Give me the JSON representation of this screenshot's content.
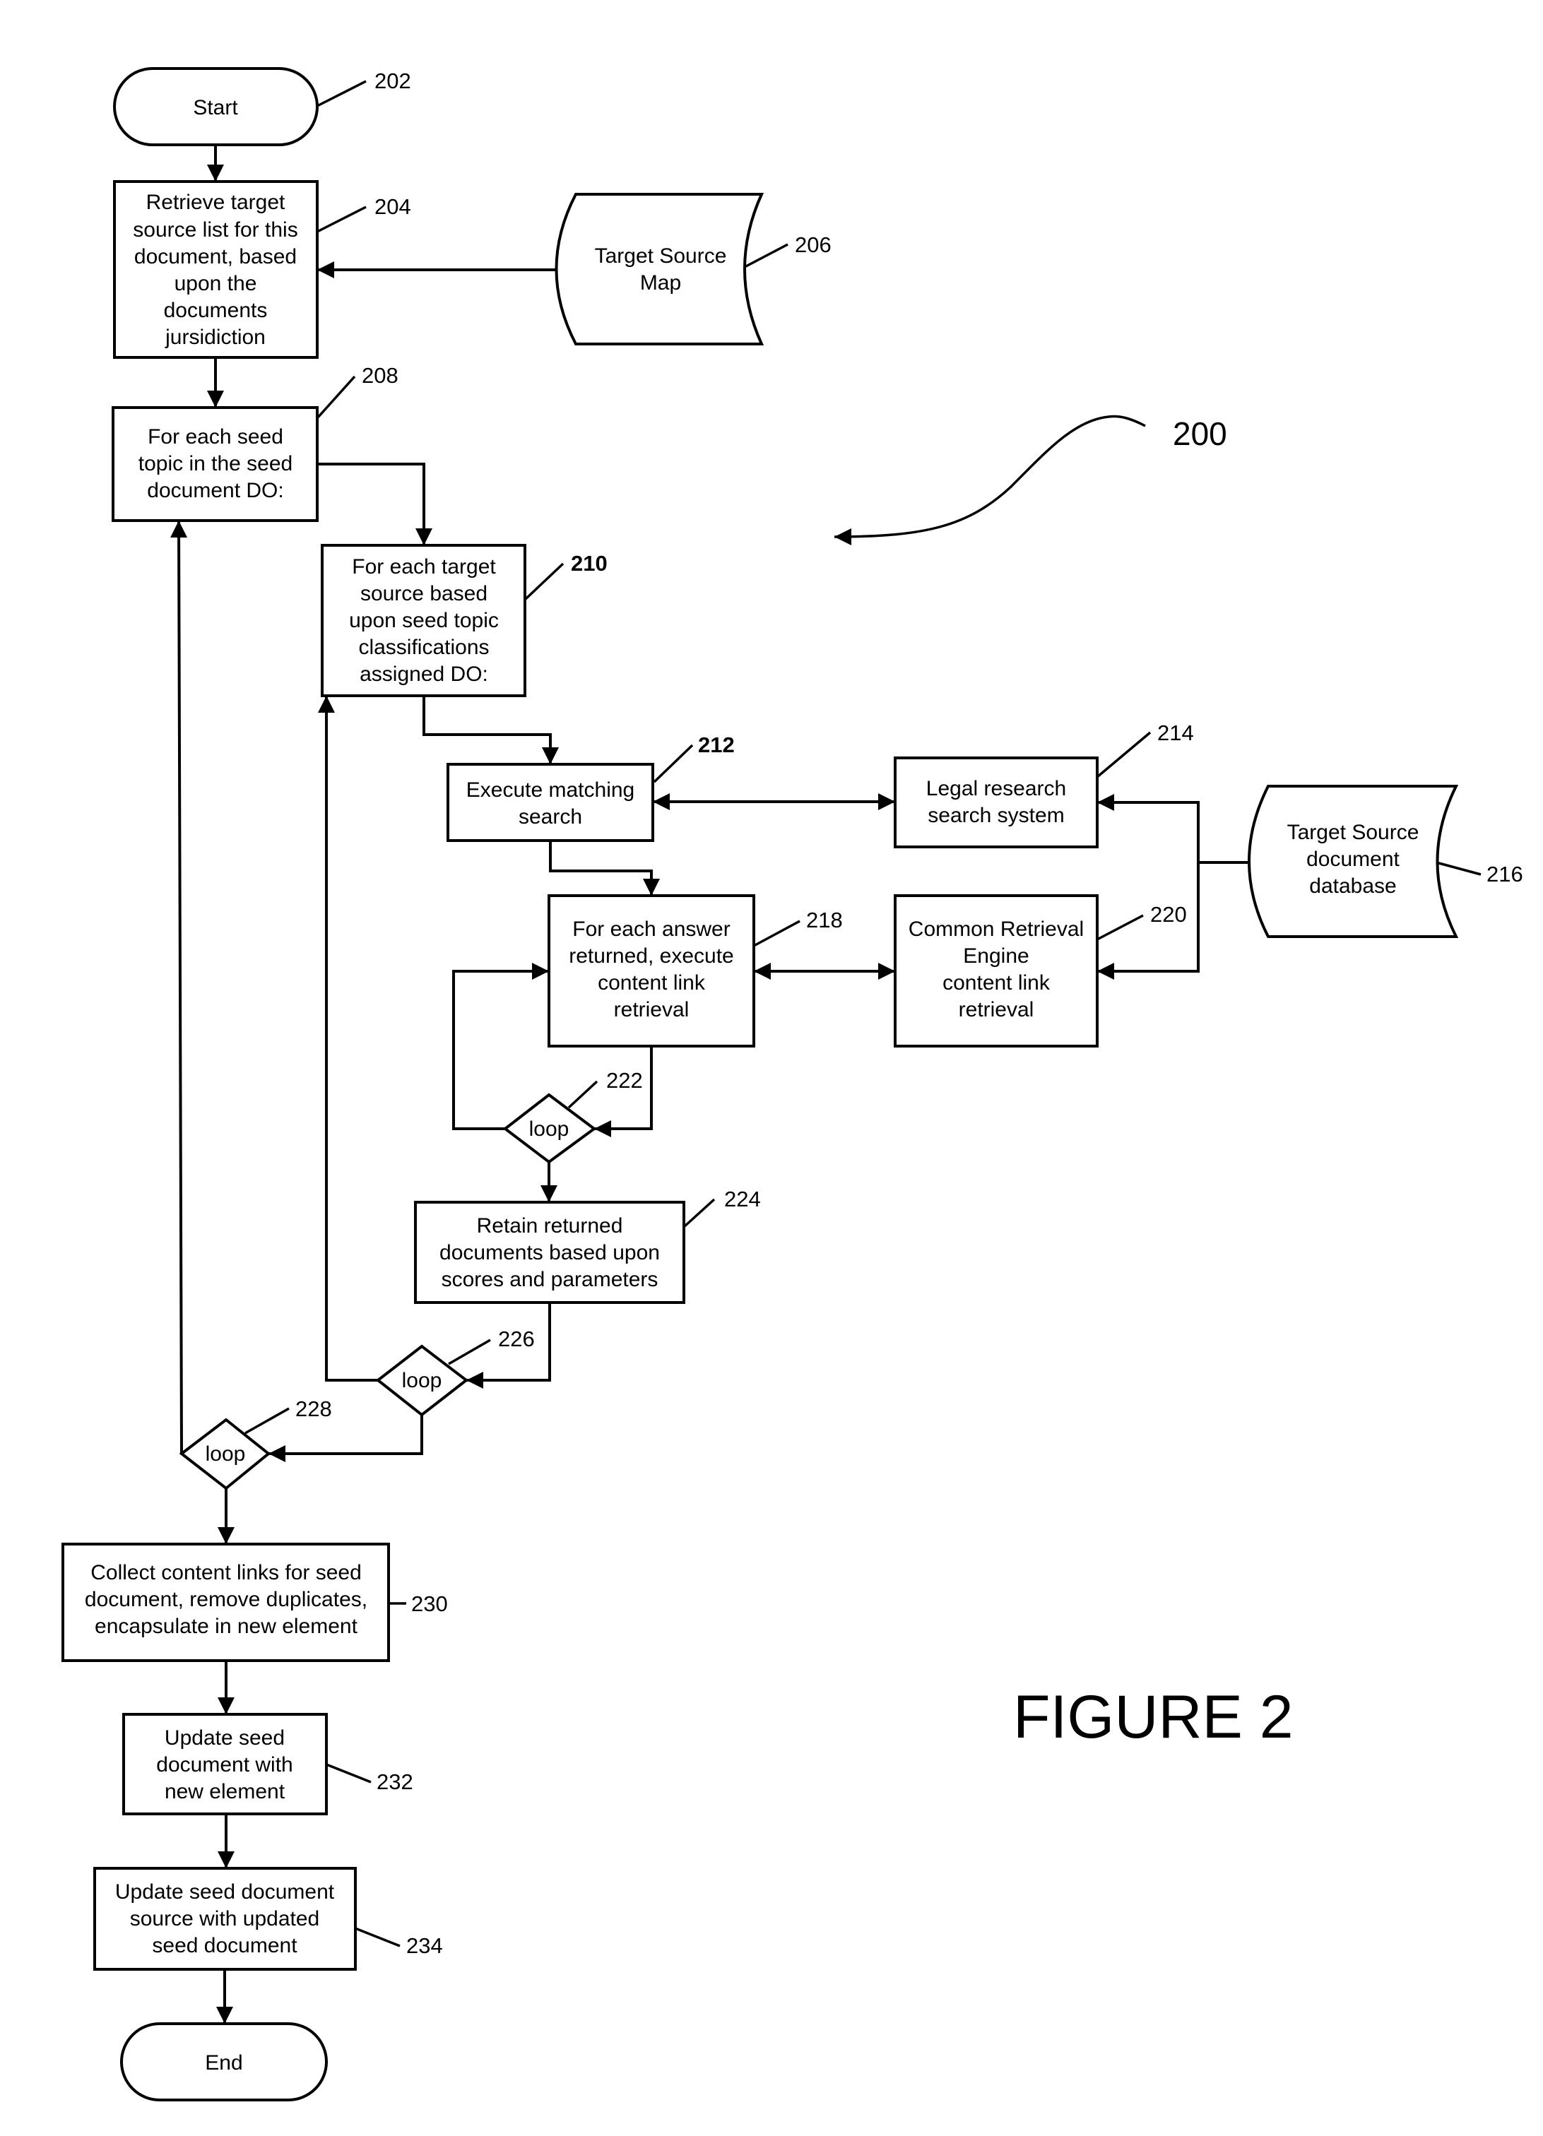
{
  "figure": {
    "caption": "FIGURE 2",
    "reference_number": "200"
  },
  "nodes": {
    "start": {
      "ref": "202",
      "shape": "terminator",
      "lines": [
        "Start"
      ]
    },
    "retrieve_target_list": {
      "ref": "204",
      "shape": "process",
      "lines": [
        "Retrieve target",
        "source list for this",
        "document, based",
        "upon the",
        "documents",
        "jursidiction"
      ]
    },
    "target_source_map": {
      "ref": "206",
      "shape": "stored-data",
      "lines": [
        "Target Source",
        "Map"
      ]
    },
    "for_each_seed_topic": {
      "ref": "208",
      "shape": "process",
      "lines": [
        "For each seed",
        "topic in the seed",
        "document DO:"
      ]
    },
    "for_each_target_source": {
      "ref": "210",
      "shape": "process",
      "lines": [
        "For each target",
        "source based",
        "upon seed topic",
        "classifications",
        "assigned DO:"
      ]
    },
    "execute_matching_search": {
      "ref": "212",
      "shape": "process",
      "lines": [
        "Execute matching",
        "search"
      ]
    },
    "legal_research_system": {
      "ref": "214",
      "shape": "process",
      "lines": [
        "Legal research",
        "search system"
      ]
    },
    "target_source_db": {
      "ref": "216",
      "shape": "stored-data",
      "lines": [
        "Target Source",
        "document",
        "database"
      ]
    },
    "for_each_answer": {
      "ref": "218",
      "shape": "process",
      "lines": [
        "For each answer",
        "returned, execute",
        "content link",
        "retrieval"
      ]
    },
    "common_retrieval_engine": {
      "ref": "220",
      "shape": "process",
      "lines": [
        "Common Retrieval",
        "Engine",
        "content link",
        "retrieval"
      ]
    },
    "loop_222": {
      "ref": "222",
      "shape": "decision",
      "lines": [
        "loop"
      ]
    },
    "retain_documents": {
      "ref": "224",
      "shape": "process",
      "lines": [
        "Retain returned",
        "documents based upon",
        "scores and parameters"
      ]
    },
    "loop_226": {
      "ref": "226",
      "shape": "decision",
      "lines": [
        "loop"
      ]
    },
    "loop_228": {
      "ref": "228",
      "shape": "decision",
      "lines": [
        "loop"
      ]
    },
    "collect_links": {
      "ref": "230",
      "shape": "process",
      "lines": [
        "Collect content links for seed",
        "document, remove duplicates,",
        "encapsulate in new element"
      ]
    },
    "update_seed_doc": {
      "ref": "232",
      "shape": "process",
      "lines": [
        "Update seed",
        "document with",
        "new element"
      ]
    },
    "update_seed_source": {
      "ref": "234",
      "shape": "process",
      "lines": [
        "Update seed document",
        "source with updated",
        "seed document"
      ]
    },
    "end": {
      "ref": "",
      "shape": "terminator",
      "lines": [
        "End"
      ]
    }
  },
  "edges": [
    {
      "from": "start",
      "to": "retrieve_target_list"
    },
    {
      "from": "target_source_map",
      "to": "retrieve_target_list"
    },
    {
      "from": "retrieve_target_list",
      "to": "for_each_seed_topic"
    },
    {
      "from": "for_each_seed_topic",
      "to": "for_each_target_source"
    },
    {
      "from": "for_each_target_source",
      "to": "execute_matching_search"
    },
    {
      "from": "execute_matching_search",
      "to": "legal_research_system",
      "bidirectional": true
    },
    {
      "from": "target_source_db",
      "to": "legal_research_system"
    },
    {
      "from": "target_source_db",
      "to": "common_retrieval_engine"
    },
    {
      "from": "execute_matching_search",
      "to": "for_each_answer"
    },
    {
      "from": "for_each_answer",
      "to": "common_retrieval_engine",
      "bidirectional": true
    },
    {
      "from": "for_each_answer",
      "to": "loop_222"
    },
    {
      "from": "loop_222",
      "to": "for_each_answer"
    },
    {
      "from": "loop_222",
      "to": "retain_documents"
    },
    {
      "from": "retain_documents",
      "to": "loop_226"
    },
    {
      "from": "loop_226",
      "to": "for_each_target_source"
    },
    {
      "from": "loop_226",
      "to": "loop_228"
    },
    {
      "from": "loop_228",
      "to": "for_each_seed_topic"
    },
    {
      "from": "loop_228",
      "to": "collect_links"
    },
    {
      "from": "collect_links",
      "to": "update_seed_doc"
    },
    {
      "from": "update_seed_doc",
      "to": "update_seed_source"
    },
    {
      "from": "update_seed_source",
      "to": "end"
    }
  ]
}
